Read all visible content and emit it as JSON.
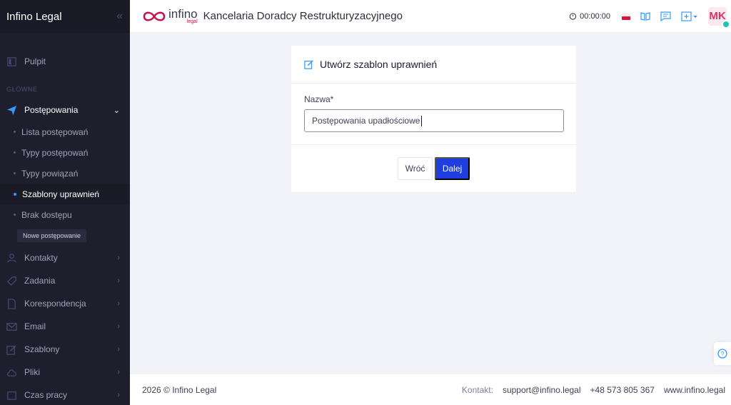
{
  "sidebar": {
    "brand": "Infino Legal",
    "collapse_icon": "chevrons-left-icon",
    "dashboard": "Pulpit",
    "section_main": "GŁÓWNE",
    "proceedings": {
      "label": "Postępowania",
      "subitems": [
        "Lista postępowań",
        "Typy postępowań",
        "Typy powiązań",
        "Szablony uprawnień",
        "Brak dostępu"
      ]
    },
    "tooltip": "Nowe postępowanie",
    "items": [
      "Kontakty",
      "Zadania",
      "Korespondencja",
      "Email",
      "Szablony",
      "Pliki",
      "Czas pracy"
    ]
  },
  "header": {
    "logo_text": "infino",
    "logo_sub": "legal",
    "office_name": "Kancelaria Doradcy Restrukturyzacyjnego",
    "timer": "00:00:00",
    "avatar_initials": "MK"
  },
  "card": {
    "title": "Utwórz szablon uprawnień",
    "field_label": "Nazwa*",
    "field_value": "Postępowania upadłościowe",
    "back_label": "Wróć",
    "next_label": "Dalej"
  },
  "footer": {
    "copyright": "2026 © Infino Legal",
    "contact_label": "Kontakt:",
    "email": "support@infino.legal",
    "phone": "+48 573 805 367",
    "website": "www.infino.legal"
  },
  "colors": {
    "sidebar_bg": "#1e1e2d",
    "primary": "#1e3ee0",
    "brand_accent": "#c4124a",
    "avatar_text": "#e0316a"
  }
}
